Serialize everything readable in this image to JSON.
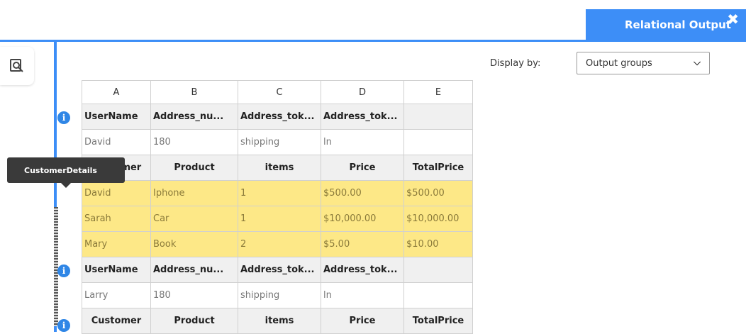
{
  "tab": {
    "title": "Relational Output",
    "close": "✖"
  },
  "tooltip": {
    "text": "CustomerDetails"
  },
  "display_by": {
    "label": "Display by:",
    "selected": "Output groups"
  },
  "grid": {
    "columns": [
      "A",
      "B",
      "C",
      "D",
      "E"
    ],
    "header1": [
      "UserName",
      "Address_nu...",
      "Address_tok...",
      "Address_tok...",
      ""
    ],
    "row1": [
      "David",
      "180",
      "shipping",
      "ln",
      ""
    ],
    "header2": [
      "Customer",
      "Product",
      "items",
      "Price",
      "TotalPrice"
    ],
    "orders": [
      [
        "David",
        "Iphone",
        "1",
        "$500.00",
        "$500.00"
      ],
      [
        "Sarah",
        "Car",
        "1",
        "$10,000.00",
        "$10,000.00"
      ],
      [
        "Mary",
        "Book",
        "2",
        "$5.00",
        "$10.00"
      ]
    ],
    "header3": [
      "UserName",
      "Address_nu...",
      "Address_tok...",
      "Address_tok...",
      ""
    ],
    "row2": [
      "Larry",
      "180",
      "shipping",
      "ln",
      ""
    ],
    "header4": [
      "Customer",
      "Product",
      "items",
      "Price",
      "TotalPrice"
    ]
  },
  "colors": {
    "accent": "#3d8ef7",
    "highlight": "#fde887"
  },
  "icons": {
    "zoom": "zoom-search-icon",
    "info": "info-icon",
    "close": "close-icon",
    "chevron": "chevron-down-icon"
  }
}
